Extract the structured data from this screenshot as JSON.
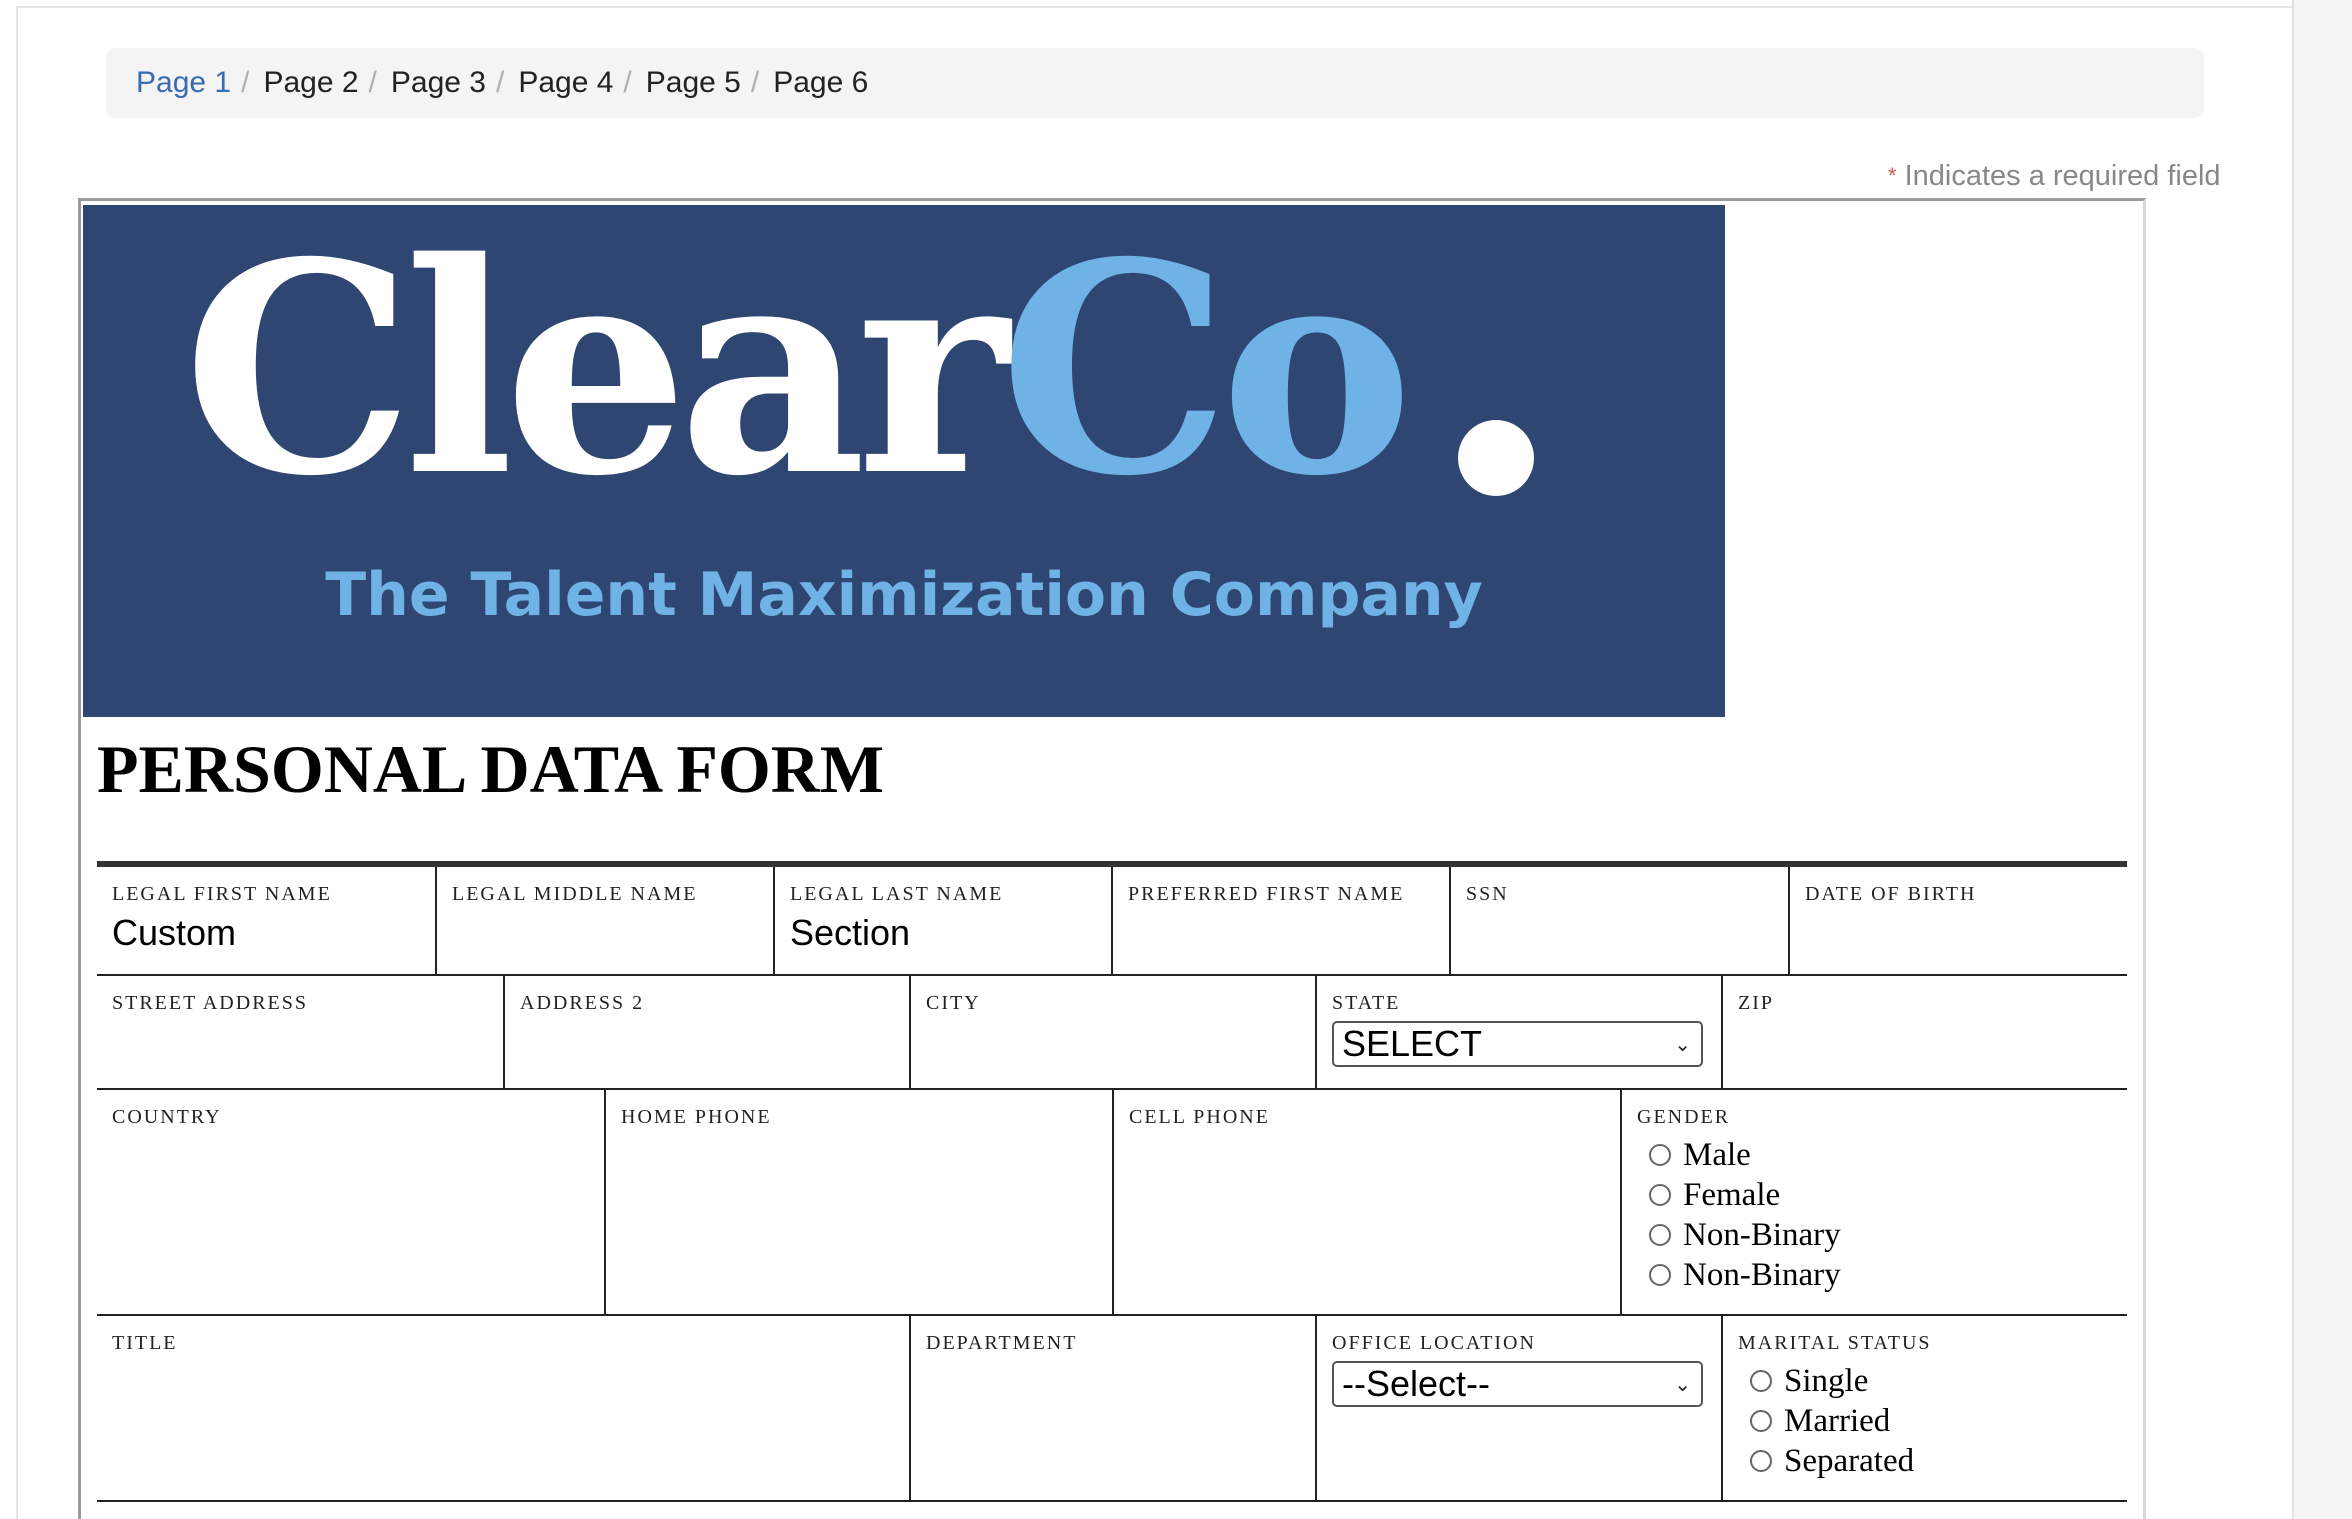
{
  "breadcrumb": {
    "items": [
      "Page 1",
      "Page 2",
      "Page 3",
      "Page 4",
      "Page 5",
      "Page 6"
    ],
    "separator": "/"
  },
  "required_note": {
    "star": "*",
    "text": "Indicates a required field"
  },
  "banner": {
    "logo_part1": "Clear",
    "logo_part2": "Co",
    "tagline": "The Talent Maximization Company",
    "colors": {
      "background": "#2f4672",
      "accent": "#6fb3e6",
      "white": "#ffffff"
    }
  },
  "form": {
    "title": "PERSONAL DATA FORM",
    "row1": {
      "legal_first_name": {
        "label": "LEGAL FIRST NAME",
        "value": "Custom"
      },
      "legal_middle_name": {
        "label": "LEGAL MIDDLE NAME",
        "value": ""
      },
      "legal_last_name": {
        "label": "LEGAL LAST NAME",
        "value": "Section"
      },
      "preferred_first_name": {
        "label": "PREFERRED FIRST NAME",
        "value": ""
      },
      "ssn": {
        "label": "SSN",
        "value": ""
      },
      "date_of_birth": {
        "label": "DATE OF BIRTH",
        "value": ""
      }
    },
    "row2": {
      "street_address": {
        "label": "STREET ADDRESS",
        "value": ""
      },
      "address2": {
        "label": "ADDRESS 2",
        "value": ""
      },
      "city": {
        "label": "CITY",
        "value": ""
      },
      "state": {
        "label": "STATE",
        "selected": "SELECT"
      },
      "zip": {
        "label": "ZIP",
        "value": ""
      }
    },
    "row3": {
      "country": {
        "label": "COUNTRY"
      },
      "home_phone": {
        "label": "HOME PHONE"
      },
      "cell_phone": {
        "label": "CELL PHONE"
      },
      "gender": {
        "label": "GENDER",
        "options": [
          "Male",
          "Female",
          "Non-Binary",
          "Non-Binary"
        ]
      }
    },
    "row4": {
      "title": {
        "label": "TITLE"
      },
      "department": {
        "label": "DEPARTMENT"
      },
      "office_location": {
        "label": "OFFICE LOCATION",
        "selected": "--Select--"
      },
      "marital_status": {
        "label": "MARITAL STATUS",
        "options": [
          "Single",
          "Married",
          "Separated"
        ]
      }
    }
  }
}
